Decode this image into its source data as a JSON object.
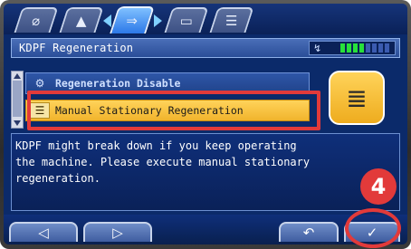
{
  "tabs": [
    {
      "icon": "leaf-icon",
      "glyph": "⌀"
    },
    {
      "icon": "machine-icon",
      "glyph": "▲"
    },
    {
      "icon": "arrow-config-icon",
      "glyph": "⇒"
    },
    {
      "icon": "card-icon",
      "glyph": "▭"
    },
    {
      "icon": "list-icon",
      "glyph": "☰"
    }
  ],
  "header": {
    "title": "KDPF Regeneration",
    "status_icon": "↯",
    "gauge_colors": [
      "#27e03a",
      "#27e03a",
      "#27e03a",
      "#27e03a",
      "#3b5bb0",
      "#3b5bb0",
      "#3b5bb0",
      "#3b5bb0"
    ]
  },
  "list": {
    "items": [
      {
        "label": "Regeneration Disable",
        "icon": "regen-disable-icon",
        "glyph": "⚙"
      },
      {
        "label": "Manual Stationary Regeneration",
        "icon": "manual-regen-icon",
        "glyph": "☰"
      }
    ]
  },
  "big_icon": {
    "glyph": "≣",
    "icon": "regeneration-exhaust-icon"
  },
  "message": {
    "text": "KDPF might break down if you keep operating\nthe machine. Please execute manual stationary\nregeneration."
  },
  "step_marker": "4",
  "footer": {
    "left_glyph": "◁",
    "right_glyph": "▷",
    "back_glyph": "↶",
    "ok_glyph": "✓"
  },
  "colors": {
    "selected_item": "#f1b42c",
    "highlight": "#e23a3a",
    "screen_bg": "#0b2a6a"
  }
}
